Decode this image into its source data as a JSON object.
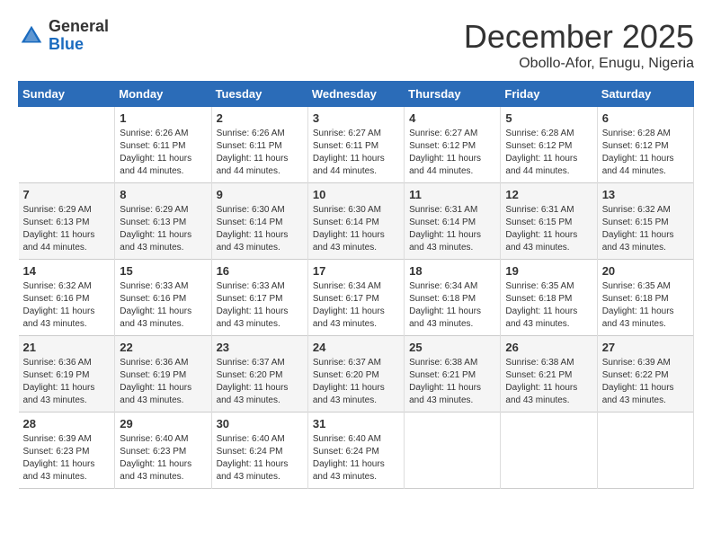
{
  "header": {
    "logo_general": "General",
    "logo_blue": "Blue",
    "month_title": "December 2025",
    "location": "Obollo-Afor, Enugu, Nigeria"
  },
  "days_of_week": [
    "Sunday",
    "Monday",
    "Tuesday",
    "Wednesday",
    "Thursday",
    "Friday",
    "Saturday"
  ],
  "weeks": [
    [
      {
        "day": "",
        "sunrise": "",
        "sunset": "",
        "daylight": ""
      },
      {
        "day": "1",
        "sunrise": "Sunrise: 6:26 AM",
        "sunset": "Sunset: 6:11 PM",
        "daylight": "Daylight: 11 hours and 44 minutes."
      },
      {
        "day": "2",
        "sunrise": "Sunrise: 6:26 AM",
        "sunset": "Sunset: 6:11 PM",
        "daylight": "Daylight: 11 hours and 44 minutes."
      },
      {
        "day": "3",
        "sunrise": "Sunrise: 6:27 AM",
        "sunset": "Sunset: 6:11 PM",
        "daylight": "Daylight: 11 hours and 44 minutes."
      },
      {
        "day": "4",
        "sunrise": "Sunrise: 6:27 AM",
        "sunset": "Sunset: 6:12 PM",
        "daylight": "Daylight: 11 hours and 44 minutes."
      },
      {
        "day": "5",
        "sunrise": "Sunrise: 6:28 AM",
        "sunset": "Sunset: 6:12 PM",
        "daylight": "Daylight: 11 hours and 44 minutes."
      },
      {
        "day": "6",
        "sunrise": "Sunrise: 6:28 AM",
        "sunset": "Sunset: 6:12 PM",
        "daylight": "Daylight: 11 hours and 44 minutes."
      }
    ],
    [
      {
        "day": "7",
        "sunrise": "Sunrise: 6:29 AM",
        "sunset": "Sunset: 6:13 PM",
        "daylight": "Daylight: 11 hours and 44 minutes."
      },
      {
        "day": "8",
        "sunrise": "Sunrise: 6:29 AM",
        "sunset": "Sunset: 6:13 PM",
        "daylight": "Daylight: 11 hours and 43 minutes."
      },
      {
        "day": "9",
        "sunrise": "Sunrise: 6:30 AM",
        "sunset": "Sunset: 6:14 PM",
        "daylight": "Daylight: 11 hours and 43 minutes."
      },
      {
        "day": "10",
        "sunrise": "Sunrise: 6:30 AM",
        "sunset": "Sunset: 6:14 PM",
        "daylight": "Daylight: 11 hours and 43 minutes."
      },
      {
        "day": "11",
        "sunrise": "Sunrise: 6:31 AM",
        "sunset": "Sunset: 6:14 PM",
        "daylight": "Daylight: 11 hours and 43 minutes."
      },
      {
        "day": "12",
        "sunrise": "Sunrise: 6:31 AM",
        "sunset": "Sunset: 6:15 PM",
        "daylight": "Daylight: 11 hours and 43 minutes."
      },
      {
        "day": "13",
        "sunrise": "Sunrise: 6:32 AM",
        "sunset": "Sunset: 6:15 PM",
        "daylight": "Daylight: 11 hours and 43 minutes."
      }
    ],
    [
      {
        "day": "14",
        "sunrise": "Sunrise: 6:32 AM",
        "sunset": "Sunset: 6:16 PM",
        "daylight": "Daylight: 11 hours and 43 minutes."
      },
      {
        "day": "15",
        "sunrise": "Sunrise: 6:33 AM",
        "sunset": "Sunset: 6:16 PM",
        "daylight": "Daylight: 11 hours and 43 minutes."
      },
      {
        "day": "16",
        "sunrise": "Sunrise: 6:33 AM",
        "sunset": "Sunset: 6:17 PM",
        "daylight": "Daylight: 11 hours and 43 minutes."
      },
      {
        "day": "17",
        "sunrise": "Sunrise: 6:34 AM",
        "sunset": "Sunset: 6:17 PM",
        "daylight": "Daylight: 11 hours and 43 minutes."
      },
      {
        "day": "18",
        "sunrise": "Sunrise: 6:34 AM",
        "sunset": "Sunset: 6:18 PM",
        "daylight": "Daylight: 11 hours and 43 minutes."
      },
      {
        "day": "19",
        "sunrise": "Sunrise: 6:35 AM",
        "sunset": "Sunset: 6:18 PM",
        "daylight": "Daylight: 11 hours and 43 minutes."
      },
      {
        "day": "20",
        "sunrise": "Sunrise: 6:35 AM",
        "sunset": "Sunset: 6:18 PM",
        "daylight": "Daylight: 11 hours and 43 minutes."
      }
    ],
    [
      {
        "day": "21",
        "sunrise": "Sunrise: 6:36 AM",
        "sunset": "Sunset: 6:19 PM",
        "daylight": "Daylight: 11 hours and 43 minutes."
      },
      {
        "day": "22",
        "sunrise": "Sunrise: 6:36 AM",
        "sunset": "Sunset: 6:19 PM",
        "daylight": "Daylight: 11 hours and 43 minutes."
      },
      {
        "day": "23",
        "sunrise": "Sunrise: 6:37 AM",
        "sunset": "Sunset: 6:20 PM",
        "daylight": "Daylight: 11 hours and 43 minutes."
      },
      {
        "day": "24",
        "sunrise": "Sunrise: 6:37 AM",
        "sunset": "Sunset: 6:20 PM",
        "daylight": "Daylight: 11 hours and 43 minutes."
      },
      {
        "day": "25",
        "sunrise": "Sunrise: 6:38 AM",
        "sunset": "Sunset: 6:21 PM",
        "daylight": "Daylight: 11 hours and 43 minutes."
      },
      {
        "day": "26",
        "sunrise": "Sunrise: 6:38 AM",
        "sunset": "Sunset: 6:21 PM",
        "daylight": "Daylight: 11 hours and 43 minutes."
      },
      {
        "day": "27",
        "sunrise": "Sunrise: 6:39 AM",
        "sunset": "Sunset: 6:22 PM",
        "daylight": "Daylight: 11 hours and 43 minutes."
      }
    ],
    [
      {
        "day": "28",
        "sunrise": "Sunrise: 6:39 AM",
        "sunset": "Sunset: 6:23 PM",
        "daylight": "Daylight: 11 hours and 43 minutes."
      },
      {
        "day": "29",
        "sunrise": "Sunrise: 6:40 AM",
        "sunset": "Sunset: 6:23 PM",
        "daylight": "Daylight: 11 hours and 43 minutes."
      },
      {
        "day": "30",
        "sunrise": "Sunrise: 6:40 AM",
        "sunset": "Sunset: 6:24 PM",
        "daylight": "Daylight: 11 hours and 43 minutes."
      },
      {
        "day": "31",
        "sunrise": "Sunrise: 6:40 AM",
        "sunset": "Sunset: 6:24 PM",
        "daylight": "Daylight: 11 hours and 43 minutes."
      },
      {
        "day": "",
        "sunrise": "",
        "sunset": "",
        "daylight": ""
      },
      {
        "day": "",
        "sunrise": "",
        "sunset": "",
        "daylight": ""
      },
      {
        "day": "",
        "sunrise": "",
        "sunset": "",
        "daylight": ""
      }
    ]
  ]
}
